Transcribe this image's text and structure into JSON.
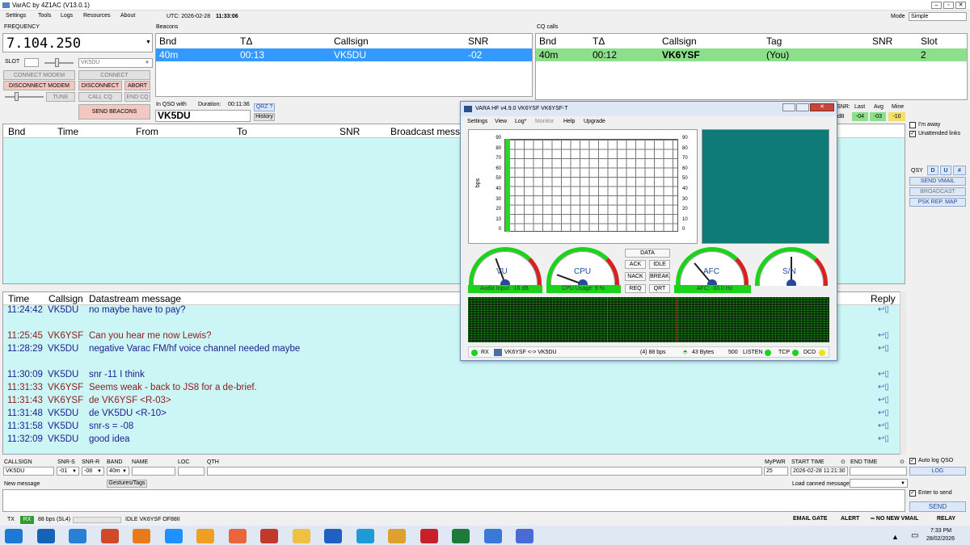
{
  "title": "VarAC by 4Z1AC (V13.0.1)",
  "menu": [
    "Settings",
    "Tools",
    "Logs",
    "Resources",
    "About"
  ],
  "utc_label": "UTC: 2026-02-28",
  "utc_time": "11:33:06",
  "mode_label": "Mode",
  "mode_value": "Simple",
  "frequency_label": "FREQUENCY",
  "frequency": "7.104.250",
  "slot_label": "SLOT",
  "slot_call": "VK5DU",
  "buttons": {
    "connect_modem": "CONNECT MODEM",
    "disconnect_modem": "DISCONNECT MODEM",
    "connect": "CONNECT",
    "disconnect": "DISCONNECT",
    "abort": "ABORT",
    "tune": "TUNE",
    "call_cq": "CALL CQ",
    "end_cq": "END CQ",
    "send_beacons": "SEND BEACONS",
    "qrz": "QRZ ?",
    "history": "History",
    "send_vmail": "SEND VMAIL",
    "broadcast": "BROADCAST",
    "psk_map": "PSK REP. MAP",
    "gestures": "Gestures/Tags",
    "log": "LOG",
    "send": "SEND"
  },
  "beacons": {
    "label": "Beacons",
    "headers": [
      "Bnd",
      "TΔ",
      "Callsign",
      "SNR"
    ],
    "rows": [
      [
        "40m",
        "00:13",
        "VK5DU",
        "-02"
      ]
    ]
  },
  "cq": {
    "label": "CQ calls",
    "headers": [
      "Bnd",
      "TΔ",
      "Callsign",
      "Tag",
      "SNR",
      "Slot"
    ],
    "rows": [
      [
        "40m",
        "00:12",
        "VK6YSF",
        "(You)",
        "",
        "2"
      ]
    ]
  },
  "qso": {
    "in_qso_label": "In QSO with",
    "duration_label": "Duration:",
    "duration": "00:11:36",
    "callsign": "VK5DU"
  },
  "snr_box": {
    "headers": [
      "SNR:",
      "Last",
      "Avg",
      "Mine"
    ],
    "unit": "dB",
    "values": [
      "-04",
      "-03",
      "-10"
    ]
  },
  "broadcast": {
    "headers": [
      "Bnd",
      "Time",
      "From",
      "To",
      "SNR",
      "Broadcast messa"
    ]
  },
  "options": {
    "away": "I'm away",
    "unattended": "Unattended links",
    "qsy": "QSY",
    "qsy_btns": [
      "D",
      "U",
      "#"
    ]
  },
  "chat": {
    "headers": [
      "Time",
      "Callsign",
      "Datastream message"
    ],
    "reply": "Reply",
    "messages": [
      {
        "time": "11:24:42",
        "call": "VK5DU",
        "text": "no maybe have to pay?",
        "mine": false
      },
      {
        "time": "11:25:45",
        "call": "VK6YSF",
        "text": "Can you hear me now Lewis?",
        "mine": true
      },
      {
        "time": "11:28:29",
        "call": "VK5DU",
        "text": "negative  Varac FM/hf voice channel needed maybe",
        "mine": false
      },
      {
        "time": "11:30:09",
        "call": "VK5DU",
        "text": "snr -11 I think",
        "mine": false
      },
      {
        "time": "11:31:33",
        "call": "VK6YSF",
        "text": "Seems weak - back to JS8 for a de-brief.",
        "mine": true
      },
      {
        "time": "11:31:43",
        "call": "VK6YSF",
        "text": "de VK6YSF <R-03>",
        "mine": true
      },
      {
        "time": "11:31:48",
        "call": "VK5DU",
        "text": "de VK5DU <R-10>",
        "mine": false
      },
      {
        "time": "11:31:58",
        "call": "VK5DU",
        "text": "snr-s = -08",
        "mine": false
      },
      {
        "time": "11:32:09",
        "call": "VK5DU",
        "text": "good idea",
        "mine": false
      }
    ]
  },
  "log": {
    "labels": [
      "CALLSIGN",
      "SNR-S",
      "SNR-R",
      "BAND",
      "NAME",
      "LOC",
      "QTH"
    ],
    "callsign": "VK5DU",
    "snr_s": "-01",
    "snr_r": "-08",
    "band": "40m",
    "mypwr_label": "MyPWR",
    "mypwr": "25",
    "start_label": "START TIME",
    "start": "2026-02-28 11:21:30",
    "end_label": "END TIME",
    "auto_log": "Auto log QSO",
    "canned": "Load canned message:"
  },
  "new_message_label": "New message",
  "enter_to_send": "Enter to send",
  "status": {
    "tx": "TX",
    "rx": "RX",
    "speed": "88 bps (SL4)",
    "idle": "IDLE  VK6YSF  OF88II",
    "email_gate": "EMAIL GATE",
    "alert": "ALERT",
    "no_vmail": "∞ NO NEW VMAIL",
    "relay": "RELAY"
  },
  "vara": {
    "title": "VARA HF v4.9.0      VK6YSF  VK6YSF-T",
    "menu": [
      "Settings",
      "View",
      "Log*",
      "Monitor",
      "Help",
      "Upgrade"
    ],
    "bps_label": "bps",
    "yticks": [
      "90",
      "80",
      "70",
      "60",
      "50",
      "40",
      "30",
      "20",
      "10",
      "0"
    ],
    "gauges": [
      "VU",
      "CPU",
      "AFC",
      "S/N"
    ],
    "audio_input": "Audio Input: -16 dB",
    "cpu_usage": "CPU Usage: 9 %",
    "afc": "AFC: -33.0 Hz",
    "buttons": [
      "DATA",
      "ACK",
      "IDLE",
      "NACK",
      "BREAK",
      "REQ",
      "QRT"
    ],
    "status_rx": "RX",
    "status_link": "VK6YSF <-> VK5DU",
    "status_speed": "(4)  88 bps",
    "status_bytes": "43 Bytes",
    "status_bw": "500",
    "status_listen": "LISTEN",
    "status_tcp": "TCP",
    "status_dcd": "DCD"
  },
  "clock": {
    "time": "7:33 PM",
    "date": "28/02/2026"
  },
  "colors": {
    "selected": "#3399ff",
    "cq_green": "#8ce08c",
    "grid_bg": "#ccf5f5",
    "chat_blue": "#1d1d8c",
    "chat_red": "#8c1c1c",
    "gauge_green": "#1bd31b"
  }
}
